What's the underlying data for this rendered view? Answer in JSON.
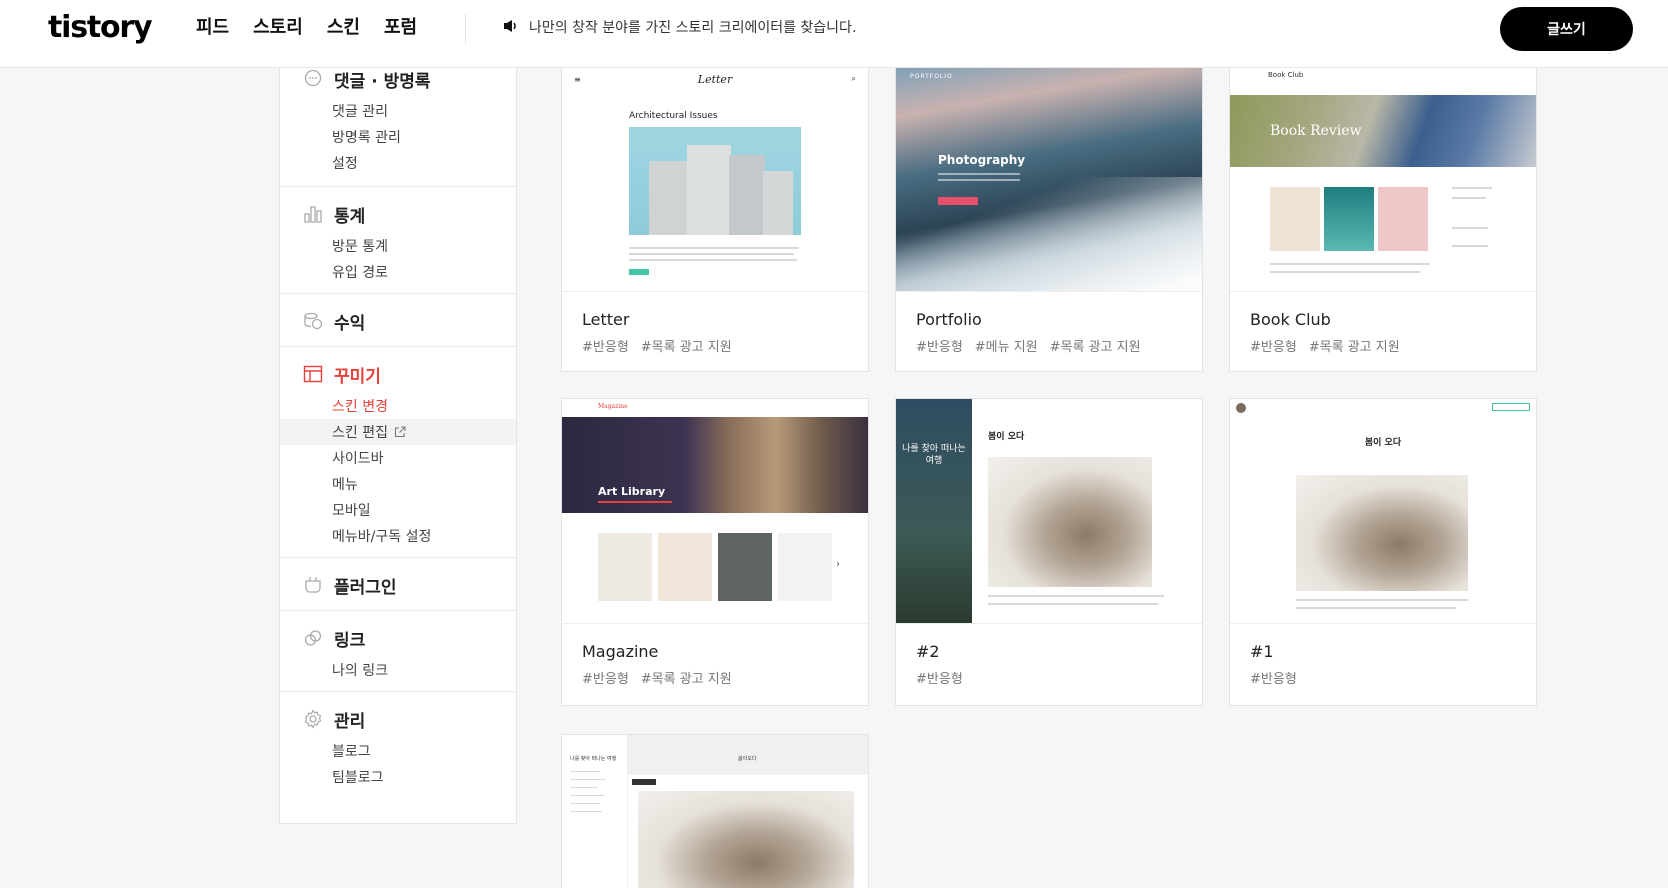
{
  "header": {
    "logo": "tistory",
    "nav": [
      "피드",
      "스토리",
      "스킨",
      "포럼"
    ],
    "notice": "나만의 창작 분야를 가진 스토리 크리에이터를 찾습니다.",
    "write_button": "글쓰기"
  },
  "sidebar": {
    "sections": [
      {
        "title": "댓글 · 방명록",
        "icon": "comment-icon",
        "items": [
          "댓글 관리",
          "방명록 관리",
          "설정"
        ]
      },
      {
        "title": "통계",
        "icon": "bar-chart-icon",
        "items": [
          "방문 통계",
          "유입 경로"
        ]
      },
      {
        "title": "수익",
        "icon": "coins-icon",
        "items": []
      },
      {
        "title": "꾸미기",
        "icon": "layout-icon",
        "items": [
          "스킨 변경",
          "스킨 편집",
          "사이드바",
          "메뉴",
          "모바일",
          "메뉴바/구독 설정"
        ],
        "active": true,
        "active_item": "스킨 변경"
      },
      {
        "title": "플러그인",
        "icon": "plugin-icon",
        "items": []
      },
      {
        "title": "링크",
        "icon": "link-icon",
        "items": [
          "나의 링크"
        ]
      },
      {
        "title": "관리",
        "icon": "gear-icon",
        "items": [
          "블로그",
          "팀블로그"
        ]
      }
    ]
  },
  "skins": [
    {
      "name": "Letter",
      "tags": [
        "#반응형",
        "#목록 광고 지원"
      ]
    },
    {
      "name": "Portfolio",
      "tags": [
        "#반응형",
        "#메뉴 지원",
        "#목록 광고 지원"
      ]
    },
    {
      "name": "Book Club",
      "tags": [
        "#반응형",
        "#목록 광고 지원"
      ]
    },
    {
      "name": "Magazine",
      "tags": [
        "#반응형",
        "#목록 광고 지원"
      ]
    },
    {
      "name": "#2",
      "tags": [
        "#반응형"
      ]
    },
    {
      "name": "#1",
      "tags": [
        "#반응형"
      ]
    },
    {
      "name": "",
      "tags": []
    }
  ],
  "thumbnails": {
    "letter": {
      "brand": "Letter",
      "headline": "Architectural Issues"
    },
    "portfolio": {
      "brand": "PORTFOLIO",
      "headline": "Photography"
    },
    "bookclub": {
      "brand": "Book Club",
      "headline": "Book Review"
    },
    "magazine": {
      "brand": "Magazine",
      "headline": "Art Library"
    },
    "skin2": {
      "side_text": "나를 찾아 떠나는 여행",
      "headline": "봄이 오다"
    },
    "skin1": {
      "headline": "봄이 오다"
    },
    "skin0": {
      "sidebar_title": "나를 찾아 떠나는 여행",
      "headline": "봄이오다"
    }
  },
  "colors": {
    "accent": "#e6403a",
    "button": "#000000"
  }
}
